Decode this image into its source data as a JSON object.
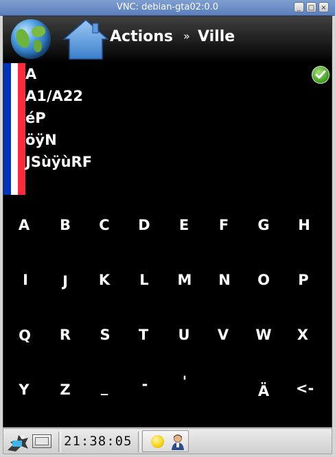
{
  "window": {
    "title": "VNC: debian-gta02:0.0",
    "minimize_glyph": "_",
    "maximize_glyph": "□",
    "close_glyph": "×"
  },
  "header": {
    "breadcrumb_parent": "Actions",
    "breadcrumb_separator": "»",
    "breadcrumb_current": "Ville"
  },
  "entries": [
    {
      "text": "A"
    },
    {
      "text": "A1/A22"
    },
    {
      "text": "éP"
    },
    {
      "text": "öÿN"
    },
    {
      "text": "JSùÿùRF"
    },
    {
      "text": ""
    }
  ],
  "keyboard": {
    "rows": [
      [
        "A",
        "B",
        "C",
        "D",
        "E",
        "F",
        "G",
        "H"
      ],
      [
        "I",
        "J",
        "K",
        "L",
        "M",
        "N",
        "O",
        "P"
      ],
      [
        "Q",
        "R",
        "S",
        "T",
        "U",
        "V",
        "W",
        "X"
      ],
      [
        "Y",
        "Z",
        "_",
        "-",
        "'",
        "",
        "Ä",
        "<-"
      ]
    ]
  },
  "taskbar": {
    "clock": "21:38:05"
  },
  "colors": {
    "flag_blue": "#0033b8",
    "flag_white": "#ffffff",
    "flag_red": "#ff2a3a",
    "titlebar": "#6a8ccb",
    "app_background": "#000000",
    "confirm_green": "#3a9a1f"
  }
}
